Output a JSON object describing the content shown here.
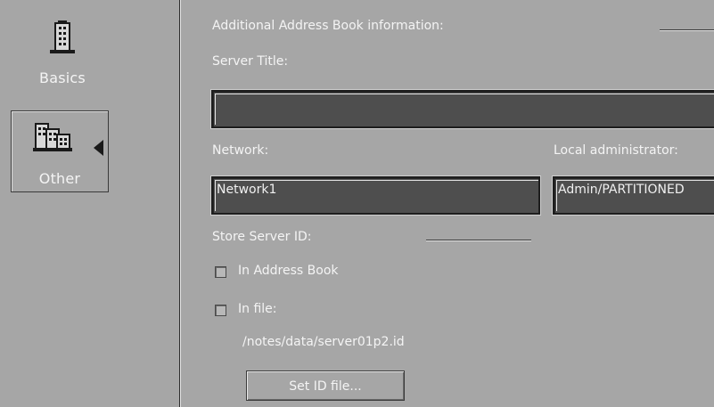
{
  "sidebar": {
    "items": [
      {
        "label": "Basics",
        "icon": "building-icon",
        "selected": false
      },
      {
        "label": "Other",
        "icon": "buildings-icon",
        "selected": true
      }
    ]
  },
  "main": {
    "section_title": "Additional Address Book information:",
    "server_title": {
      "label": "Server Title:",
      "value": ""
    },
    "network": {
      "label": "Network:",
      "value": "Network1"
    },
    "local_admin": {
      "label": "Local administrator:",
      "value": "Admin/PARTITIONED"
    },
    "store_server_id": {
      "label": "Store Server ID:"
    },
    "in_address_book": {
      "label": "In Address Book",
      "checked": false
    },
    "in_file": {
      "label": "In file:",
      "checked": false
    },
    "id_file_path": "/notes/data/server01p2.id",
    "set_id_button": "Set ID file..."
  }
}
